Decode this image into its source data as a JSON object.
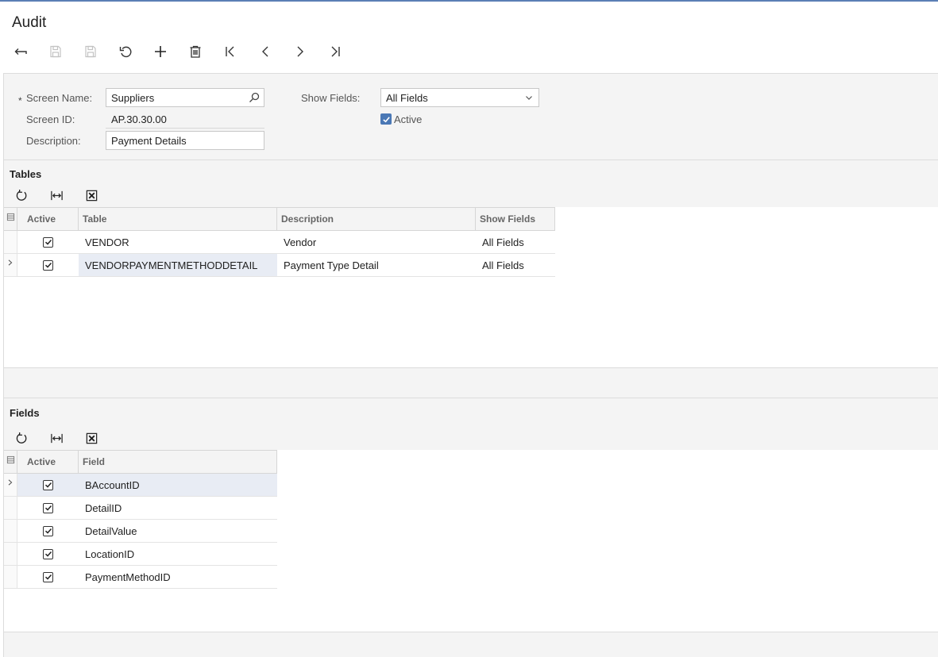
{
  "page": {
    "title": "Audit"
  },
  "toolbar": {
    "buttons": [
      {
        "name": "back-button",
        "icon": "undo-arrow-icon",
        "enabled": true
      },
      {
        "name": "save-close-button",
        "icon": "save-close-icon",
        "enabled": false
      },
      {
        "name": "save-button",
        "icon": "save-icon",
        "enabled": false
      },
      {
        "name": "cancel-button",
        "icon": "revert-icon",
        "enabled": true
      },
      {
        "name": "add-button",
        "icon": "plus-icon",
        "enabled": true
      },
      {
        "name": "delete-button",
        "icon": "trash-icon",
        "enabled": true
      },
      {
        "name": "first-button",
        "icon": "first-record-icon",
        "enabled": true
      },
      {
        "name": "previous-button",
        "icon": "chevron-left-icon",
        "enabled": true
      },
      {
        "name": "next-button",
        "icon": "chevron-right-icon",
        "enabled": true
      },
      {
        "name": "last-button",
        "icon": "last-record-icon",
        "enabled": true
      }
    ]
  },
  "form": {
    "required_marker": "*",
    "screen_name_label": "Screen Name:",
    "screen_name_value": "Suppliers",
    "screen_id_label": "Screen ID:",
    "screen_id_value": "AP.30.30.00",
    "description_label": "Description:",
    "description_value": "Payment Details",
    "show_fields_label": "Show Fields:",
    "show_fields_value": "All Fields",
    "active_label": "Active",
    "active_checked": true
  },
  "tables": {
    "title": "Tables",
    "columns": [
      "Active",
      "Table",
      "Description",
      "Show Fields"
    ],
    "rows": [
      {
        "active": true,
        "table": "VENDOR",
        "description": "Vendor",
        "show_fields": "All Fields",
        "selected": false
      },
      {
        "active": true,
        "table": "VENDORPAYMENTMETHODDETAIL",
        "description": "Payment Type Detail",
        "show_fields": "All Fields",
        "selected": true
      }
    ]
  },
  "fields": {
    "title": "Fields",
    "columns": [
      "Active",
      "Field"
    ],
    "rows": [
      {
        "active": true,
        "field": "BAccountID",
        "selected": true
      },
      {
        "active": true,
        "field": "DetailID",
        "selected": false
      },
      {
        "active": true,
        "field": "DetailValue",
        "selected": false
      },
      {
        "active": true,
        "field": "LocationID",
        "selected": false
      },
      {
        "active": true,
        "field": "PaymentMethodID",
        "selected": false
      }
    ]
  },
  "colors": {
    "accent": "#4a78b5",
    "panel": "#f4f4f4",
    "selected_row": "#e8ecf4"
  }
}
